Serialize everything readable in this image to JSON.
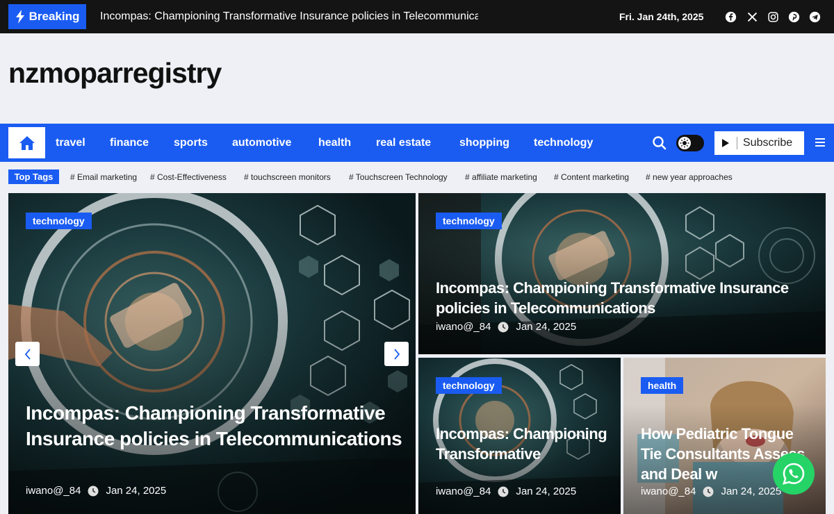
{
  "topbar": {
    "breaking_label": "Breaking",
    "ticker_text": "Incompas: Championing Transformative Insurance policies in Telecommunications",
    "date": "Fri. Jan 24th, 2025",
    "social_icons": [
      "facebook-icon",
      "x-icon",
      "instagram-icon",
      "pinterest-icon",
      "telegram-icon"
    ]
  },
  "header": {
    "site_title": "nzmoparregistry"
  },
  "nav": {
    "items": [
      "travel",
      "finance",
      "sports",
      "automotive",
      "health",
      "real estate",
      "shopping",
      "technology"
    ],
    "subscribe_label": "Subscribe"
  },
  "tags": {
    "label": "Top Tags",
    "items": [
      "Email marketing",
      "Cost-Effectiveness",
      "touchscreen monitors",
      "Touchscreen Technology",
      "affiliate marketing",
      "Content marketing",
      "new year approaches"
    ]
  },
  "featured": {
    "main": {
      "category": "technology",
      "title": "Incompas: Championing Transformative Insurance policies in Telecommunications",
      "author": "iwano@_84",
      "date": "Jan 24, 2025"
    },
    "top_right": {
      "category": "technology",
      "title": "Incompas: Championing Transformative Insurance policies in Telecommunications",
      "author": "iwano@_84",
      "date": "Jan 24, 2025"
    },
    "bottom_mid": {
      "category": "technology",
      "title": "Incompas: Championing Transformative",
      "author": "iwano@_84",
      "date": "Jan 24, 2025"
    },
    "bottom_right": {
      "category": "health",
      "title": "How Pediatric Tongue Tie Consultants Assess and Deal w",
      "author": "iwano@_84",
      "date": "Jan 24, 2025"
    }
  },
  "colors": {
    "accent": "#1a5cf2",
    "topbar_bg": "#141414",
    "whatsapp": "#25d366"
  }
}
